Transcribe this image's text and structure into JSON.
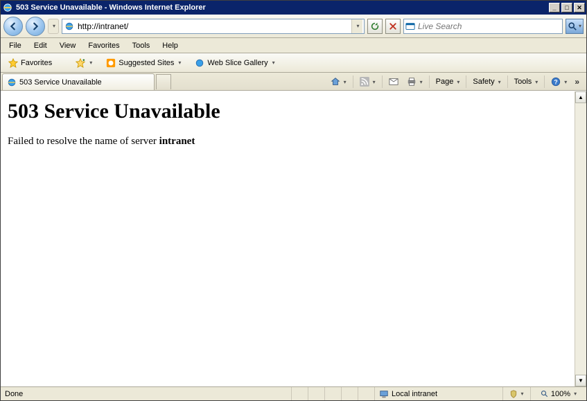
{
  "window": {
    "title": "503 Service Unavailable - Windows Internet Explorer"
  },
  "nav": {
    "url": "http://intranet/",
    "refresh_icon": "refresh-icon",
    "stop_icon": "stop-icon"
  },
  "search": {
    "provider_icon": "outlook-icon",
    "placeholder": "Live Search",
    "go_icon": "magnifier-icon"
  },
  "menus": [
    "File",
    "Edit",
    "View",
    "Favorites",
    "Tools",
    "Help"
  ],
  "favbar": {
    "favorites_label": "Favorites",
    "suggested_label": "Suggested Sites",
    "webslice_label": "Web Slice Gallery"
  },
  "tab": {
    "title": "503 Service Unavailable"
  },
  "commandbar": {
    "page": "Page",
    "safety": "Safety",
    "tools": "Tools"
  },
  "page": {
    "heading": "503 Service Unavailable",
    "body_prefix": "Failed to resolve the name of server ",
    "body_bold": "intranet"
  },
  "status": {
    "left": "Done",
    "zone": "Local intranet",
    "zoom": "100%"
  }
}
